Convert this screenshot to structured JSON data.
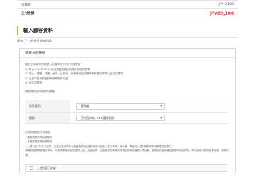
{
  "summary": {
    "rows": [
      {
        "label": "消費稅",
        "value": "JPY 8,100"
      },
      {
        "label": "支付金額",
        "value": "JPY89,100"
      }
    ]
  },
  "customer_section": {
    "title": "輸入顧客資料",
    "required_note_prefix": "標有「",
    "required_star": "*",
    "required_note_suffix": "」的項目皆為必填。"
  },
  "license_card": {
    "heading": "駕駛執照種類",
    "intro_lines": [
      "欲在日本租車的駕駛人必須持有下列許可證駕照：",
      "1. 符合1949年9月19日的道路交通公約規定的國際駕照",
      "2. 瑞士、德國、法國、台灣、比利時、斯洛維尼亞或摩納哥核發的駕照以及日文譯本。",
      "3. 由日本當局核發的有效駕駛許可證",
      "4. 日本的駕照"
    ],
    "select_prompt": "請選擇您所持駕照的種類。",
    "fields": [
      {
        "label": "發行國家",
        "required_star": "*",
        "value": "臺灣省"
      },
      {
        "label": "種類",
        "required_star": "*",
        "value": "日內瓦公約(1949)國際駕照"
      }
    ],
    "notes": [
      "日本的駕照的有效期為",
      "- 國際駕照的有效期間內",
      "- 本國駕照的有效期間內",
      "- 入境日起1年內（但是，已登記住民票本台帳者離境後回國3個月內再度入境日本時，將以最一開始的入境日視為本有效期間的起算日）",
      "為確認國際駕照是否有效，可能需要確認顧客護照上的入出國紀錄。如因使用的駕照不符規定而無法確認入境日期，若無法在當地確認顧客所持的駕照，則可能無法提供租車服務，敬請注意。"
    ],
    "confirm_label": "上述內容已確認*"
  },
  "icons": {
    "dropdown": "chevron-down-icon",
    "checkbox": "checkbox-icon"
  },
  "colors": {
    "accent_bar": "#e8a33c",
    "price_red": "#d64545",
    "required_red": "#d64545"
  }
}
